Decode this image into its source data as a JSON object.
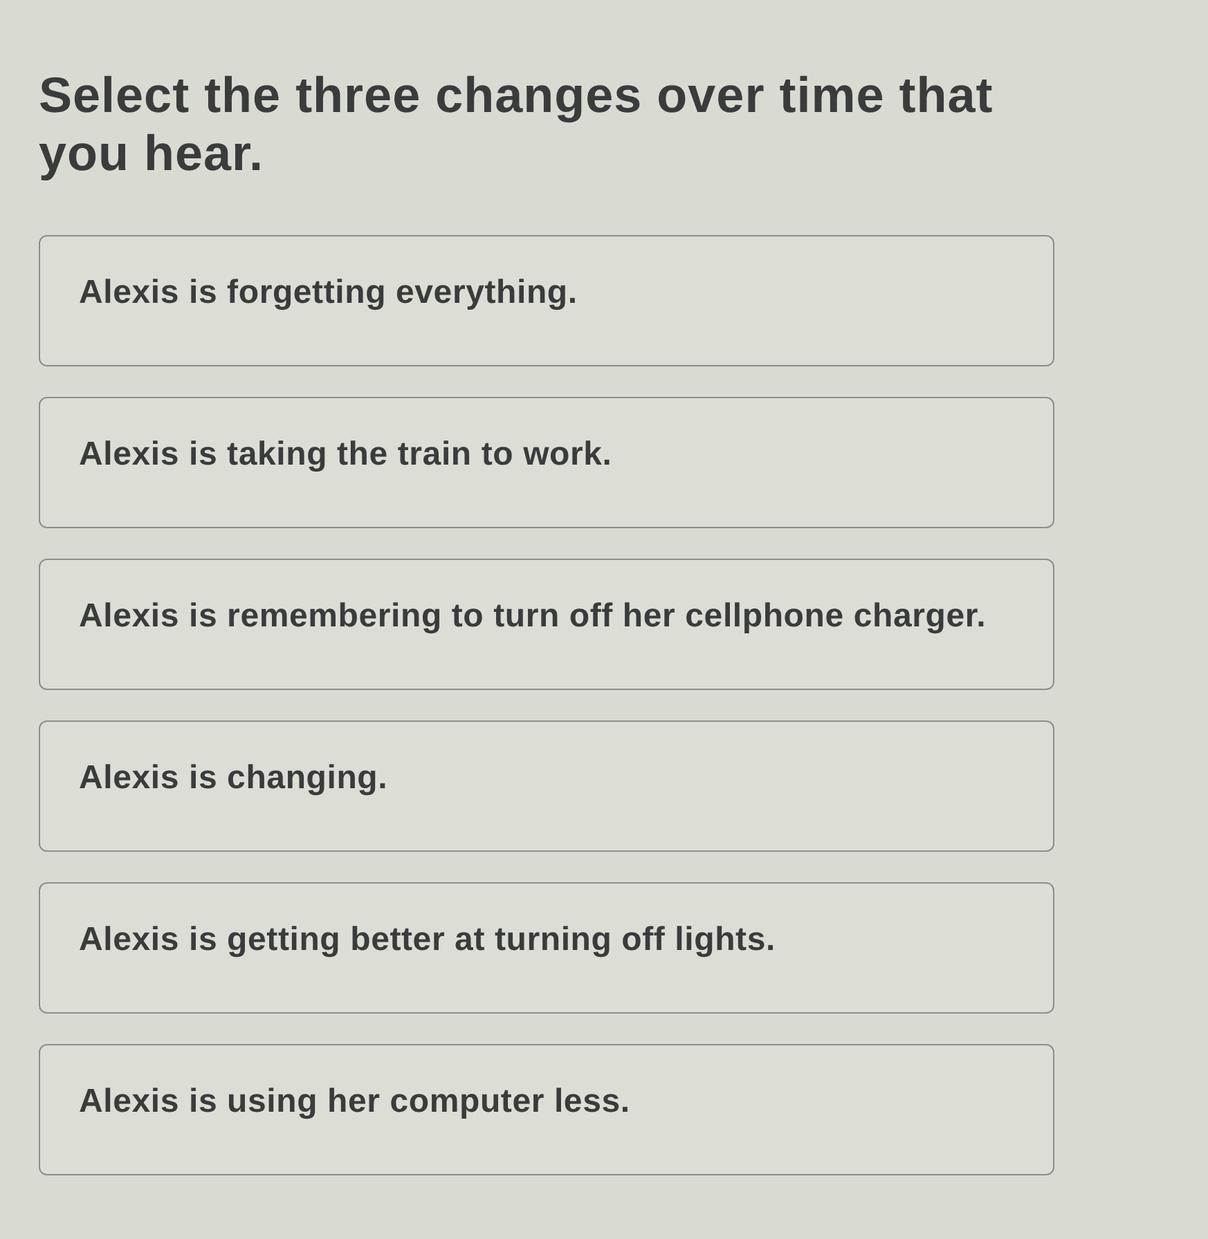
{
  "question": "Select the three changes over time that you hear.",
  "options": [
    {
      "label": "Alexis is forgetting everything.",
      "selected": false
    },
    {
      "label": "Alexis is taking the train to work.",
      "selected": false
    },
    {
      "label": "Alexis is remembering to turn off her cellphone charger.",
      "selected": false
    },
    {
      "label": "Alexis is changing.",
      "selected": false
    },
    {
      "label": "Alexis is getting better at turning off lights.",
      "selected": false
    },
    {
      "label": "Alexis is using her computer less.",
      "selected": false
    }
  ]
}
